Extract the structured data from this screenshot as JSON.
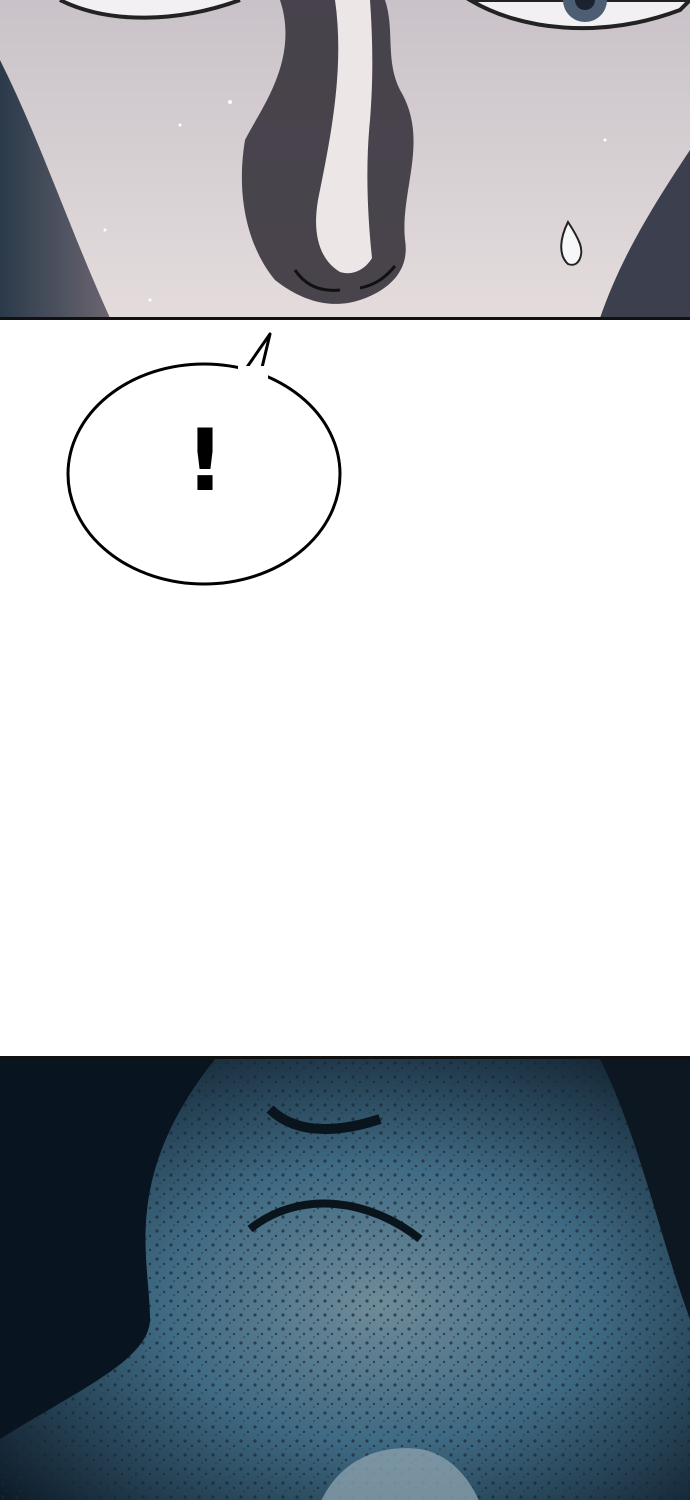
{
  "speech_bubble": {
    "text": "!"
  },
  "colors": {
    "skin": "#d6cfd2",
    "shadow": "#3c3740",
    "cold_blue": "#2f5d7e",
    "dark_bg": "#0b1824",
    "outline": "#111111"
  }
}
